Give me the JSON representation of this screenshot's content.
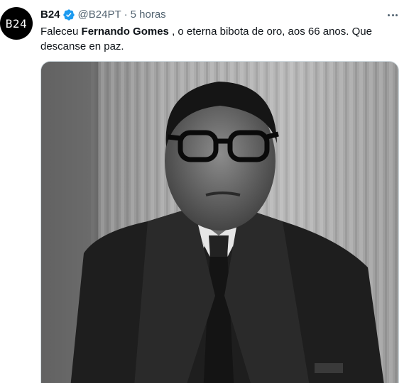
{
  "tweet": {
    "display_name": "B24",
    "handle": "@B24PT",
    "separator": "·",
    "time": "5 horas",
    "avatar_text": "B24",
    "text_before": "Faleceu ",
    "text_bold": "Fernando Gomes",
    "text_after": " , o eterna bibota de oro, aos 66 anos. Que descanse en paz."
  },
  "colors": {
    "verified": "#1d9bf0",
    "secondary_text": "#536471",
    "primary_text": "#0f1419"
  },
  "icons": {
    "verified": "verified-badge-icon",
    "more": "more-options-icon"
  }
}
